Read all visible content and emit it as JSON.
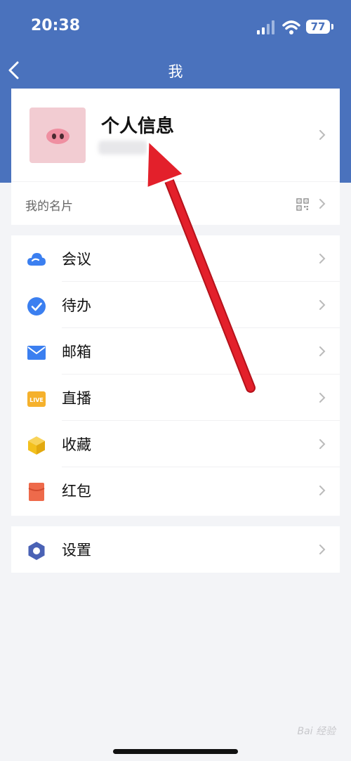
{
  "status_bar": {
    "time": "20:38",
    "battery": "77"
  },
  "nav": {
    "title": "我"
  },
  "profile": {
    "name": "个人信息",
    "card_label": "我的名片"
  },
  "menu": [
    {
      "label": "会议",
      "icon": "cloud-icon"
    },
    {
      "label": "待办",
      "icon": "check-circle-icon"
    },
    {
      "label": "邮箱",
      "icon": "mail-icon"
    },
    {
      "label": "直播",
      "icon": "live-icon"
    },
    {
      "label": "收藏",
      "icon": "box-icon"
    },
    {
      "label": "红包",
      "icon": "red-envelope-icon"
    }
  ],
  "settings": {
    "label": "设置",
    "icon": "settings-hex-icon"
  },
  "watermark": "Bai 经验",
  "colors": {
    "header": "#4a72bd",
    "arrow": "#e3202b",
    "background": "#f3f4f7"
  }
}
